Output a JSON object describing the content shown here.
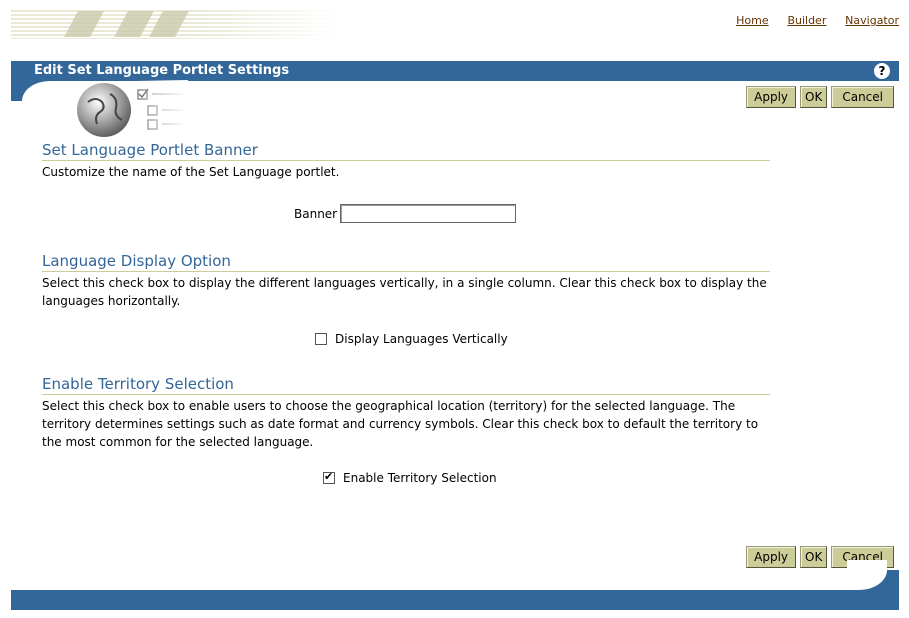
{
  "header": {
    "links": [
      "Home",
      "Builder",
      "Navigator"
    ]
  },
  "page": {
    "title": "Edit Set Language Portlet Settings",
    "help_label": "?"
  },
  "buttons": {
    "apply": "Apply",
    "ok": "OK",
    "cancel": "Cancel"
  },
  "sections": {
    "banner": {
      "heading": "Set Language Portlet Banner",
      "description": "Customize the name of the Set Language portlet.",
      "field_label": "Banner",
      "field_value": ""
    },
    "display": {
      "heading": "Language Display Option",
      "description": "Select this check box to display the different languages vertically, in a single column. Clear this check box to display the languages horizontally.",
      "checkbox_label": "Display Languages Vertically",
      "checked": false
    },
    "territory": {
      "heading": "Enable Territory Selection",
      "description": "Select this check box to enable users to choose the geographical location (territory) for the selected language. The territory determines settings such as date format and currency symbols. Clear this check box to default the territory to the most common for the selected language.",
      "checkbox_label": "Enable Territory Selection",
      "checked": true
    }
  },
  "colors": {
    "bar": "#336699",
    "link": "#663300",
    "button": "#cccc99",
    "heading": "#336699"
  }
}
